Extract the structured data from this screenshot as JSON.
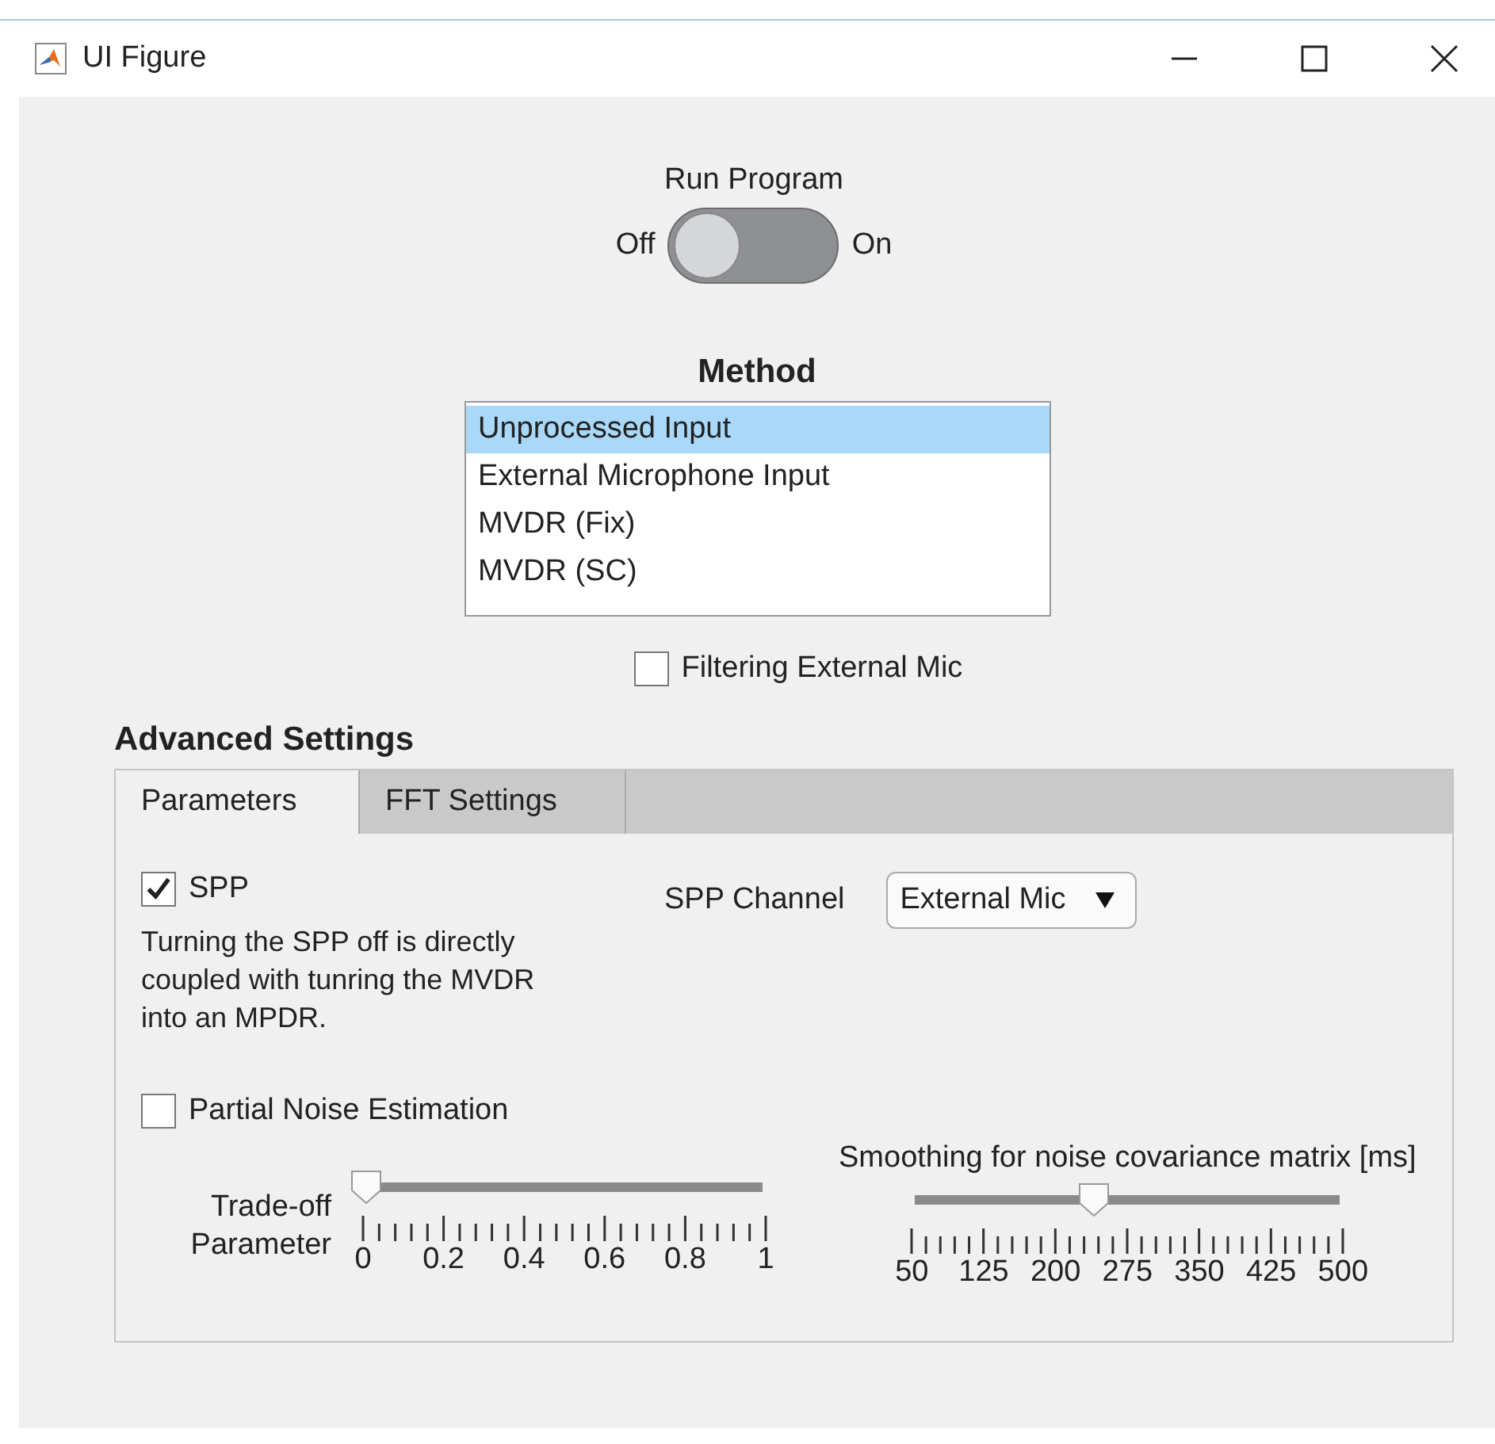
{
  "window": {
    "title": "UI Figure"
  },
  "run_program": {
    "label": "Run Program",
    "off_label": "Off",
    "on_label": "On",
    "on": false
  },
  "method": {
    "title": "Method",
    "items": [
      {
        "label": "Unprocessed Input",
        "selected": true
      },
      {
        "label": "External Microphone Input",
        "selected": false
      },
      {
        "label": "MVDR (Fix)",
        "selected": false
      },
      {
        "label": "MVDR (SC)",
        "selected": false
      }
    ]
  },
  "filtering_external_mic": {
    "label": "Filtering External Mic",
    "checked": false
  },
  "advanced_settings": {
    "title": "Advanced Settings",
    "tabs": [
      {
        "label": "Parameters",
        "selected": true
      },
      {
        "label": "FFT Settings",
        "selected": false
      }
    ],
    "spp": {
      "label": "SPP",
      "checked": true
    },
    "description": "Turning the SPP off is directly coupled with tunring the MVDR into an MPDR.",
    "spp_channel": {
      "label": "SPP Channel",
      "value": "External Mic"
    },
    "partial_noise": {
      "label": "Partial Noise Estimation",
      "checked": false
    },
    "sliders": [
      {
        "kind": "side",
        "label": "Trade-off Parameter",
        "level": 0,
        "ticks": [
          "0",
          "0.2",
          "0.4",
          "0.6",
          "0.8",
          "1"
        ]
      },
      {
        "kind": "top",
        "label": "Smoothing for noise covariance matrix [ms]",
        "level": 0.42,
        "ticks": [
          "50",
          "125",
          "200",
          "275",
          "350",
          "425",
          "500"
        ]
      }
    ]
  }
}
